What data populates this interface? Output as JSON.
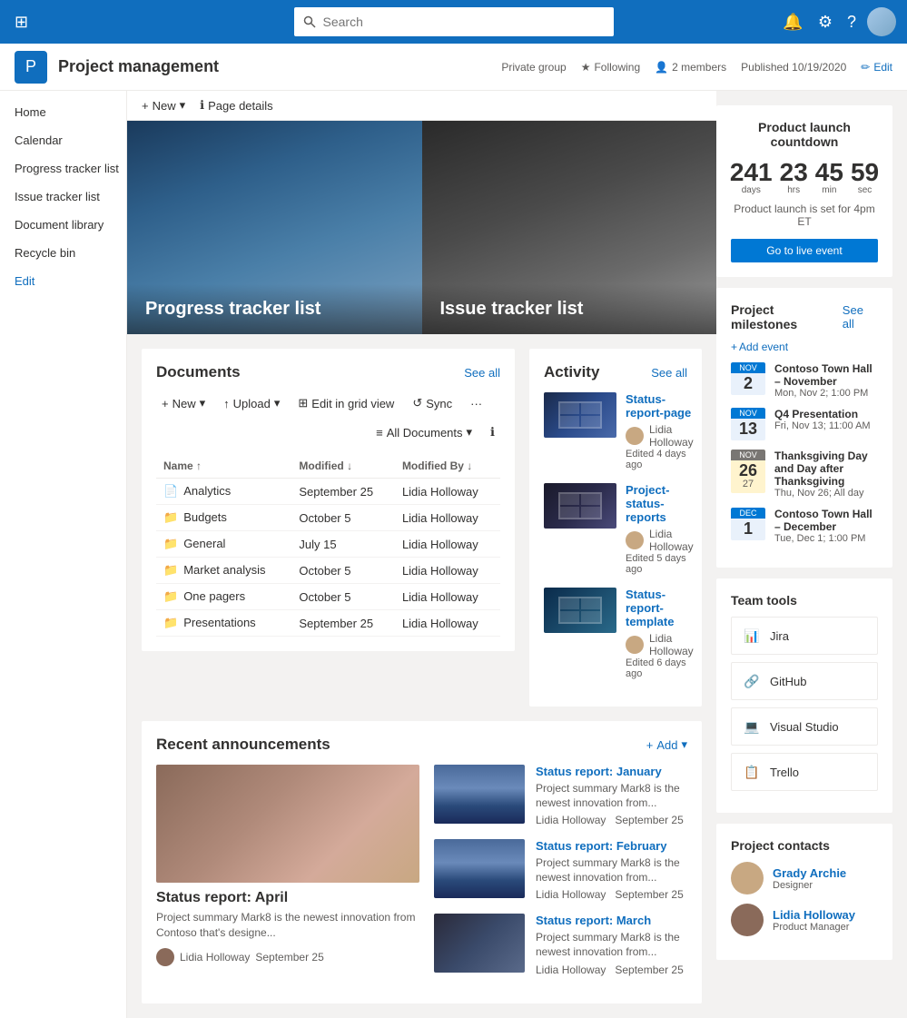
{
  "topnav": {
    "search_placeholder": "Search",
    "waffle_icon": "⊞"
  },
  "siteheader": {
    "title": "Project management",
    "logo_letter": "P",
    "private_group": "Private group",
    "following": "Following",
    "members": "2 members",
    "published": "Published 10/19/2020",
    "edit": "Edit"
  },
  "page_actions": {
    "new_label": "New",
    "page_details_label": "Page details"
  },
  "hero": {
    "left_title": "Progress tracker list",
    "right_title": "Issue tracker list"
  },
  "documents": {
    "section_title": "Documents",
    "see_all": "See all",
    "toolbar": {
      "new_label": "New",
      "upload_label": "Upload",
      "edit_grid_label": "Edit in grid view",
      "sync_label": "Sync",
      "all_docs_label": "All Documents"
    },
    "columns": [
      "Name",
      "Modified",
      "Modified By"
    ],
    "rows": [
      {
        "icon": "file",
        "name": "Analytics",
        "modified": "September 25",
        "modified_by": "Lidia Holloway"
      },
      {
        "icon": "folder",
        "name": "Budgets",
        "modified": "October 5",
        "modified_by": "Lidia Holloway"
      },
      {
        "icon": "folder",
        "name": "General",
        "modified": "July 15",
        "modified_by": "Lidia Holloway"
      },
      {
        "icon": "folder",
        "name": "Market analysis",
        "modified": "October 5",
        "modified_by": "Lidia Holloway"
      },
      {
        "icon": "folder",
        "name": "One pagers",
        "modified": "October 5",
        "modified_by": "Lidia Holloway"
      },
      {
        "icon": "folder",
        "name": "Presentations",
        "modified": "September 25",
        "modified_by": "Lidia Holloway"
      }
    ]
  },
  "activity": {
    "section_title": "Activity",
    "see_all": "See all",
    "items": [
      {
        "title": "Status-report-page",
        "author": "Lidia Holloway",
        "time": "Edited 4 days ago"
      },
      {
        "title": "Project-status-reports",
        "author": "Lidia Holloway",
        "time": "Edited 5 days ago"
      },
      {
        "title": "Status-report-template",
        "author": "Lidia Holloway",
        "time": "Edited 6 days ago"
      }
    ]
  },
  "announcements": {
    "section_title": "Recent announcements",
    "add_label": "Add",
    "featured": {
      "title": "Status report: April",
      "description": "Project summary Mark8 is the newest innovation from Contoso that's designe...",
      "author": "Lidia Holloway",
      "date": "September 25"
    },
    "items": [
      {
        "title": "Status report: January",
        "description": "Project summary Mark8 is the newest innovation from...",
        "author": "Lidia Holloway",
        "date": "September 25"
      },
      {
        "title": "Status report: February",
        "description": "Project summary Mark8 is the newest innovation from...",
        "author": "Lidia Holloway",
        "date": "September 25"
      },
      {
        "title": "Status report: March",
        "description": "Project summary Mark8 is the newest innovation from...",
        "author": "Lidia Holloway",
        "date": "September 25"
      }
    ]
  },
  "countdown": {
    "title": "Product launch countdown",
    "days": "241",
    "hrs": "23",
    "min": "45",
    "sec": "59",
    "days_label": "days",
    "hrs_label": "hrs",
    "min_label": "min",
    "sec_label": "sec",
    "description": "Product launch is set for 4pm ET",
    "button_label": "Go to live event"
  },
  "milestones": {
    "title": "Project milestones",
    "see_all": "See all",
    "add_event": "Add event",
    "items": [
      {
        "month": "NOV",
        "day": "2",
        "name": "Contoso Town Hall – November",
        "time": "Mon, Nov 2; 1:00 PM",
        "type": "normal"
      },
      {
        "month": "NOV",
        "day": "13",
        "name": "Q4 Presentation",
        "time": "Fri, Nov 13; 11:00 AM",
        "type": "normal"
      },
      {
        "month": "NOV",
        "day": "26",
        "day2": "27",
        "name": "Thanksgiving Day and Day after Thanksgiving",
        "time": "Thu, Nov 26; All day",
        "type": "multiday"
      },
      {
        "month": "DEC",
        "day": "1",
        "name": "Contoso Town Hall – December",
        "time": "Tue, Dec 1; 1:00 PM",
        "type": "normal"
      }
    ]
  },
  "team_tools": {
    "title": "Team tools",
    "items": [
      {
        "name": "Jira",
        "icon": "📊"
      },
      {
        "name": "GitHub",
        "icon": "🔗"
      },
      {
        "name": "Visual Studio",
        "icon": "💻"
      },
      {
        "name": "Trello",
        "icon": "📋"
      }
    ]
  },
  "project_contacts": {
    "title": "Project contacts",
    "contacts": [
      {
        "name": "Grady Archie",
        "role": "Designer"
      },
      {
        "name": "Lidia Holloway",
        "role": "Product Manager"
      }
    ]
  }
}
